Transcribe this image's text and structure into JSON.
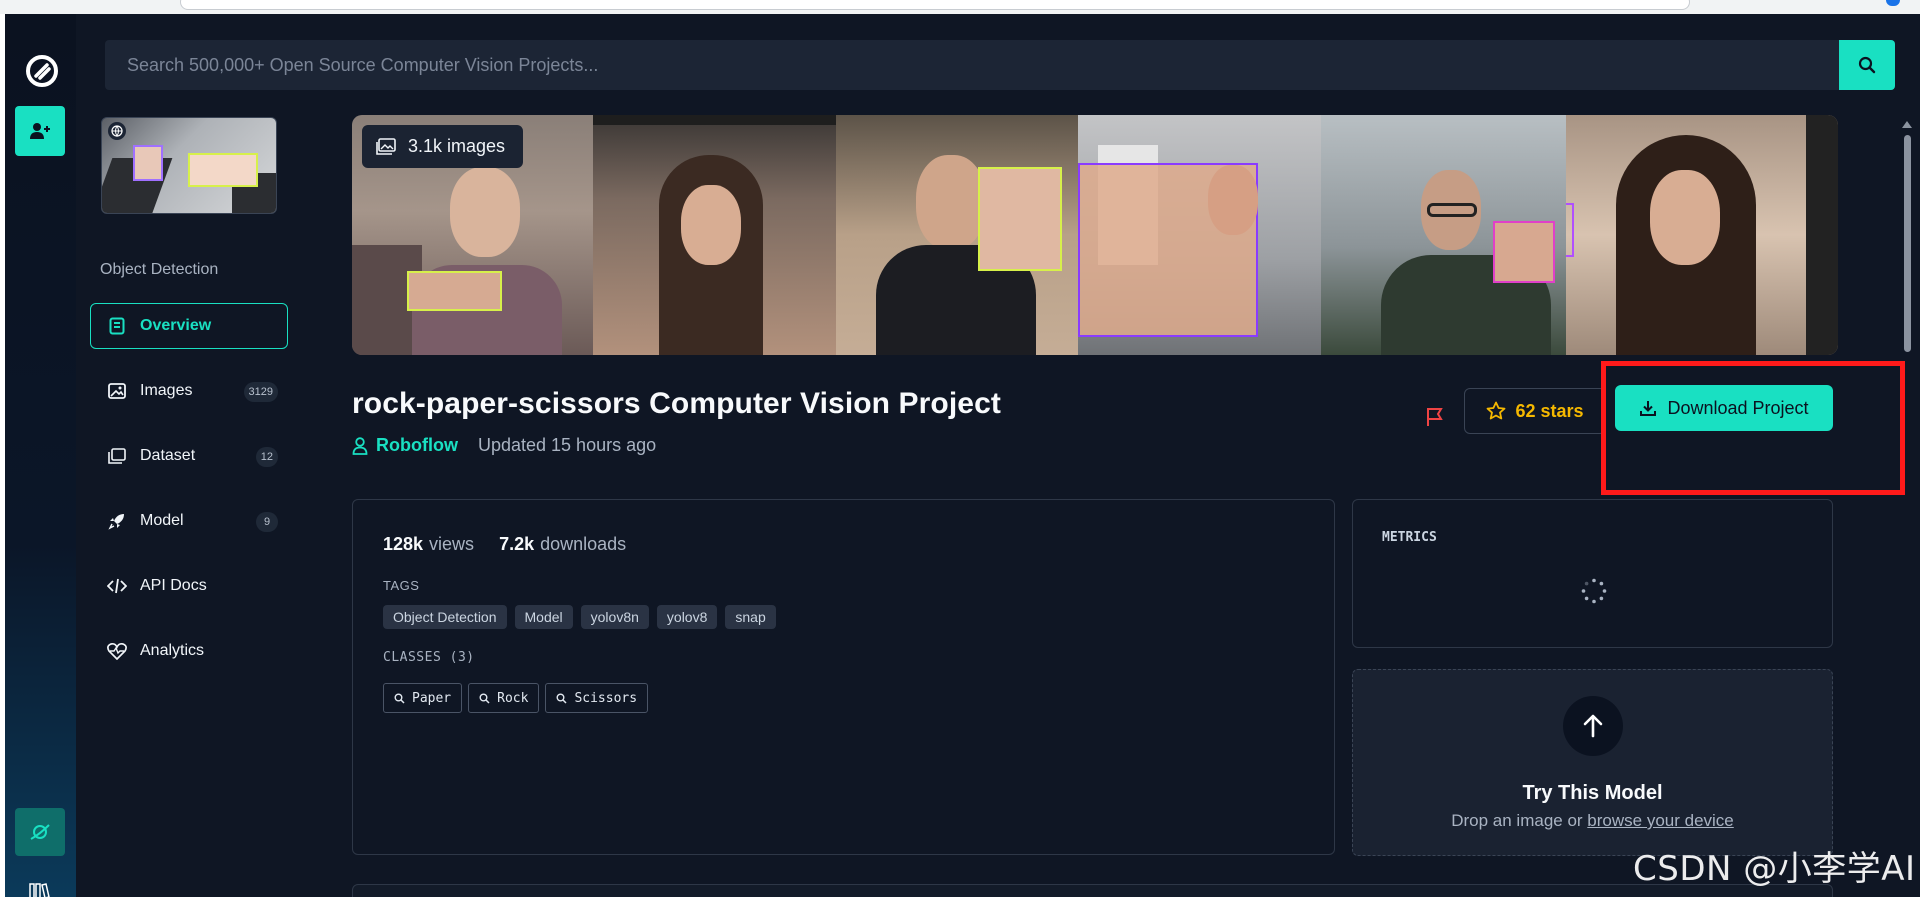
{
  "search": {
    "placeholder": "Search 500,000+ Open Source Computer Vision Projects..."
  },
  "project": {
    "type": "Object Detection",
    "title": "rock-paper-scissors Computer Vision Project",
    "owner": "Roboflow",
    "updated": "Updated 15 hours ago",
    "image_badge": "3.1k images"
  },
  "sidebar": {
    "items": [
      {
        "label": "Overview",
        "icon": "overview-icon",
        "active": true
      },
      {
        "label": "Images",
        "icon": "images-icon",
        "count": "3129"
      },
      {
        "label": "Dataset",
        "icon": "dataset-icon",
        "count": "12"
      },
      {
        "label": "Model",
        "icon": "rocket-icon",
        "count": "9"
      },
      {
        "label": "API Docs",
        "icon": "code-icon"
      },
      {
        "label": "Analytics",
        "icon": "heart-pulse-icon"
      }
    ]
  },
  "actions": {
    "stars": "62 stars",
    "download": "Download Project"
  },
  "stats": {
    "views_value": "128k",
    "views_label": "views",
    "downloads_value": "7.2k",
    "downloads_label": "downloads"
  },
  "tags_label": "TAGS",
  "tags": [
    "Object Detection",
    "Model",
    "yolov8n",
    "yolov8",
    "snap"
  ],
  "classes_label": "CLASSES (3)",
  "classes": [
    "Paper",
    "Rock",
    "Scissors"
  ],
  "metrics": {
    "label": "METRICS"
  },
  "try_model": {
    "heading": "Try This Model",
    "text": "Drop an image or ",
    "link": "browse your device"
  },
  "watermark": "CSDN @小李学AI",
  "colors": {
    "accent": "#19e0c2",
    "star": "#f5b800",
    "flag": "#ef4444",
    "highlight": "#ff1a1a",
    "background": "#0f1624"
  }
}
